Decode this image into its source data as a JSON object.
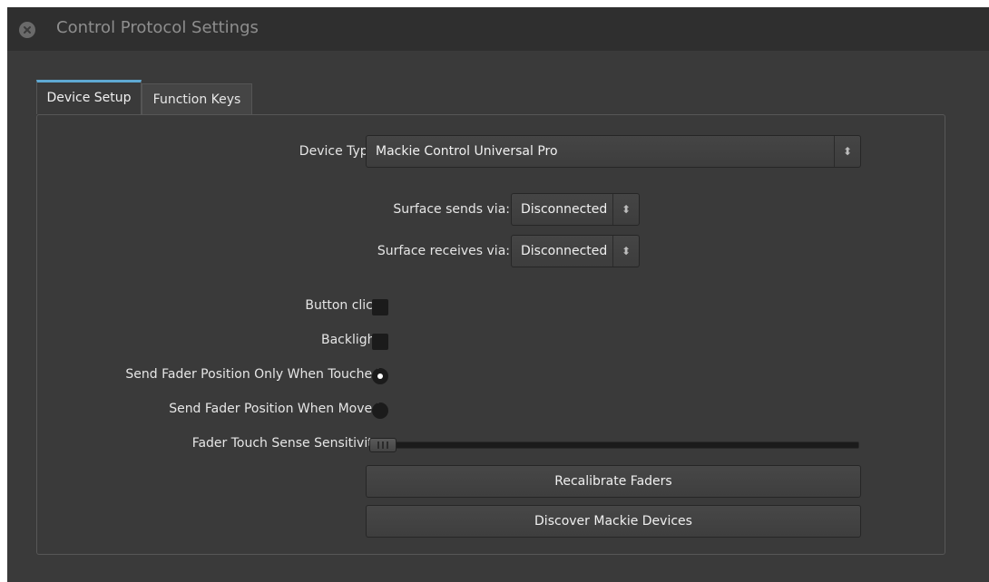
{
  "window": {
    "title": "Control Protocol Settings"
  },
  "tabs": [
    {
      "label": "Device Setup",
      "active": true
    },
    {
      "label": "Function Keys",
      "active": false
    }
  ],
  "device_setup": {
    "device_type_label": "Device Type:",
    "device_type_value": "Mackie Control Universal Pro",
    "surface_sends_label": "Surface sends via:",
    "surface_sends_value": "Disconnected",
    "surface_receives_label": "Surface receives via:",
    "surface_receives_value": "Disconnected",
    "button_click_label": "Button click",
    "button_click_checked": false,
    "backlight_label": "Backlight",
    "backlight_checked": false,
    "fader_touched_label": "Send Fader Position Only When Touched",
    "fader_touched_selected": true,
    "fader_moved_label": "Send Fader Position When Moved",
    "fader_moved_selected": false,
    "sensitivity_label": "Fader Touch Sense Sensitivity",
    "sensitivity_value": 0,
    "recalibrate_label": "Recalibrate Faders",
    "discover_label": "Discover Mackie Devices"
  },
  "colors": {
    "accent": "#5fa9d3",
    "background": "#3a3a3a"
  }
}
